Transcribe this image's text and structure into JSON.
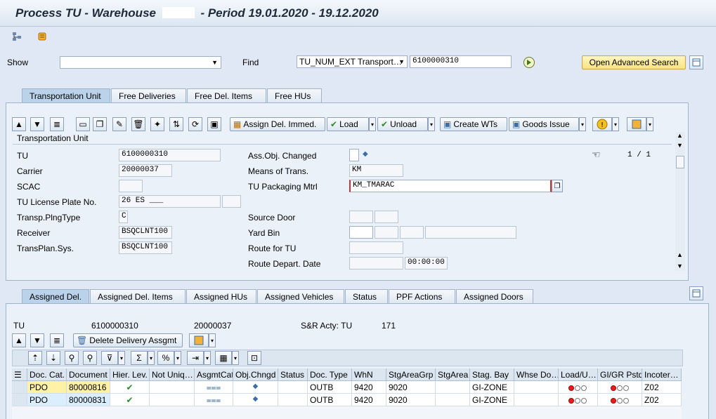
{
  "window": {
    "title_prefix": "Process TU - Warehouse",
    "title_suffix": "- Period 19.01.2020 - 19.12.2020"
  },
  "search": {
    "show_label": "Show",
    "show_value": "",
    "find_label": "Find",
    "find_field": "TU_NUM_EXT Transport…",
    "find_value": "6100000310",
    "advanced_search": "Open Advanced Search"
  },
  "top_tabs": [
    "Transportation Unit",
    "Free Deliveries",
    "Free Del. Items",
    "Free HUs"
  ],
  "toolbar": {
    "assign": "Assign Del. Immed.",
    "load": "Load",
    "unload": "Unload",
    "create_wts": "Create WTs",
    "goods_issue": "Goods Issue"
  },
  "tu_section": {
    "heading": "Transportation Unit",
    "pager": "1 / 1",
    "left": [
      {
        "label": "TU",
        "value": "6100000310"
      },
      {
        "label": "Carrier",
        "value": "20000037"
      },
      {
        "label": "SCAC",
        "value": ""
      },
      {
        "label": "TU License Plate No.",
        "value": "26 ES ___"
      },
      {
        "label": "Transp.PlngType",
        "value": "C"
      },
      {
        "label": "Receiver",
        "value": "BSQCLNT100"
      },
      {
        "label": "TransPlan.Sys.",
        "value": "BSQCLNT100"
      }
    ],
    "right": {
      "ass_obj_changed": "Ass.Obj. Changed",
      "means_of_trans": "Means of Trans.",
      "means_value": "KM",
      "packaging": "TU Packaging Mtrl",
      "packaging_value": "KM_TMARAC",
      "source_door": "Source Door",
      "yard_bin": "Yard Bin",
      "route": "Route for TU",
      "route_depart": "Route Depart. Date",
      "route_time": "00:00:00"
    }
  },
  "bottom_tabs": [
    "Assigned Del.",
    "Assigned Del. Items",
    "Assigned HUs",
    "Assigned Vehicles",
    "Status",
    "PPF Actions",
    "Assigned Doors"
  ],
  "summary": {
    "tu_label": "TU",
    "tu_value": "6100000310",
    "carrier_value": "20000037",
    "sr_label": "S&R Acty: TU",
    "sr_value": "171"
  },
  "delete_button": "Delete Delivery Assgmt",
  "grid": {
    "columns": [
      "Doc. Cat.",
      "Document",
      "Hier. Lev.",
      "Not Uniq…",
      "AsgmtCat",
      "Obj.Chngd",
      "Status",
      "Doc. Type",
      "WhN",
      "StgAreaGrp",
      "StgArea",
      "Stag. Bay",
      "Whse Do…",
      "Load/U…",
      "GI/GR Pstd",
      "Incoter…"
    ],
    "rows": [
      {
        "doc_cat": "PDO",
        "document": "80000816",
        "doc_type": "OUTB",
        "whn": "9420",
        "stg_area_grp": "9020",
        "stag_bay": "GI-ZONE",
        "incoterm": "Z02"
      },
      {
        "doc_cat": "PDO",
        "document": "80000831",
        "doc_type": "OUTB",
        "whn": "9420",
        "stg_area_grp": "9020",
        "stag_bay": "GI-ZONE",
        "incoterm": "Z02"
      }
    ]
  },
  "colors": {
    "accent_tab": "#bad2ea",
    "highlight_cell": "#fff1a6",
    "status_red": "#e02020"
  }
}
